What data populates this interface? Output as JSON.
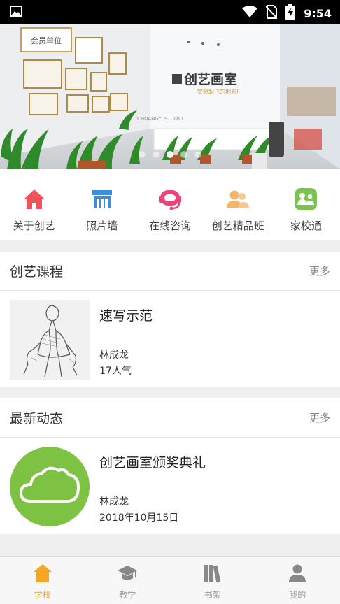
{
  "status_bar": {
    "time": "9:54",
    "icons": [
      "image-icon",
      "wifi-icon",
      "no-sim-icon",
      "battery-charging-icon"
    ]
  },
  "banner": {
    "sign_text": "创艺画室",
    "sign_sub": "梦想起飞的地方!",
    "studio_text": "CHUANGYI STUDIO",
    "wall_text": "会员单位",
    "slides": 5,
    "active_slide": 3
  },
  "quick_nav": [
    {
      "label": "关于创艺",
      "icon": "home-icon",
      "color": "#f0545a"
    },
    {
      "label": "照片墙",
      "icon": "storefront-icon",
      "color": "#3a8fde"
    },
    {
      "label": "在线咨询",
      "icon": "headset-icon",
      "color": "#f0427a"
    },
    {
      "label": "创艺精品班",
      "icon": "group-icon",
      "color": "#f3b569"
    },
    {
      "label": "家校通",
      "icon": "family-icon",
      "color": "#7cc24e"
    }
  ],
  "courses": {
    "title": "创艺课程",
    "more": "更多",
    "items": [
      {
        "title": "速写示范",
        "author": "林成龙",
        "popularity": "17人气"
      }
    ]
  },
  "news": {
    "title": "最新动态",
    "more": "更多",
    "items": [
      {
        "title": "创艺画室颁奖典礼",
        "author": "林成龙",
        "date": "2018年10月15日",
        "thumb_color": "#7dc242"
      }
    ]
  },
  "tabs": [
    {
      "label": "学校",
      "icon": "school-icon",
      "active": true
    },
    {
      "label": "教学",
      "icon": "graduation-cap-icon",
      "active": false
    },
    {
      "label": "书架",
      "icon": "bookshelf-icon",
      "active": false
    },
    {
      "label": "我的",
      "icon": "person-icon",
      "active": false
    }
  ],
  "colors": {
    "accent": "#f5a623",
    "inactive": "#999999"
  }
}
